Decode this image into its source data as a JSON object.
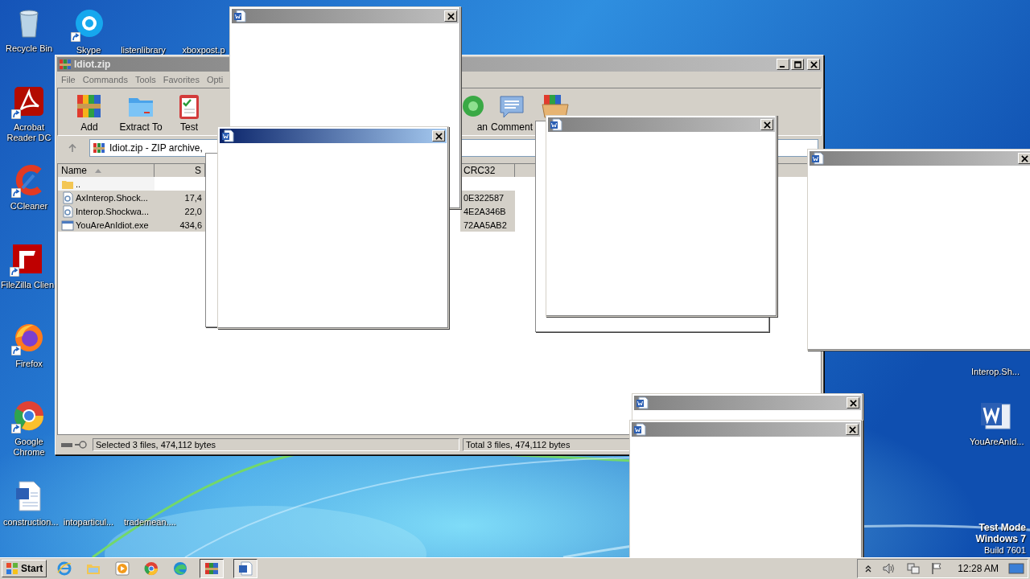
{
  "desktop_icons": [
    {
      "label": "Recycle Bin",
      "kind": "recycle",
      "shortcut": false
    },
    {
      "label": "Skype",
      "kind": "chat",
      "shortcut": true
    },
    {
      "label": "listenlibrary",
      "kind": "blank",
      "shortcut": false
    },
    {
      "label": "xboxpost.p",
      "kind": "blank",
      "shortcut": false
    },
    {
      "label": "Acrobat Reader DC",
      "kind": "pdf",
      "shortcut": true
    },
    {
      "label": "CCleaner",
      "kind": "cleaner",
      "shortcut": true
    },
    {
      "label": "FileZilla Clien",
      "kind": "ftp",
      "shortcut": true
    },
    {
      "label": "Firefox",
      "kind": "firefox",
      "shortcut": true
    },
    {
      "label": "Google Chrome",
      "kind": "chrome",
      "shortcut": true
    },
    {
      "label": "construction...",
      "kind": "doc",
      "shortcut": false
    },
    {
      "label": "intoparticul...",
      "kind": "blank",
      "shortcut": false
    },
    {
      "label": "trademean....",
      "kind": "blank",
      "shortcut": false
    },
    {
      "label": "Interop.Sh...",
      "kind": "blank",
      "shortcut": false
    },
    {
      "label": "YouAreAnId...",
      "kind": "word",
      "shortcut": false
    }
  ],
  "winrar": {
    "title": "Idiot.zip",
    "menu": [
      "File",
      "Commands",
      "Tools",
      "Favorites",
      "Opti"
    ],
    "toolbar": [
      {
        "label": "Add",
        "kind": "add"
      },
      {
        "label": "Extract To",
        "kind": "extract"
      },
      {
        "label": "Test",
        "kind": "test"
      },
      {
        "label": "an",
        "kind": "scan"
      },
      {
        "label": "Comment",
        "kind": "comment"
      },
      {
        "kind": "sfx"
      }
    ],
    "address": "Idiot.zip - ZIP archive,",
    "columns": [
      {
        "label": "Name",
        "sorted": true
      },
      {
        "label": "S",
        "sorted": false
      },
      {
        "label": "CRC32",
        "sorted": false
      }
    ],
    "rows": [
      {
        "name": "..",
        "kind": "folder",
        "selected": false
      },
      {
        "name": "AxInterop.Shock...",
        "kind": "dll",
        "size": "17,4",
        "crc": "0E322587",
        "selected": true
      },
      {
        "name": "Interop.Shockwa...",
        "kind": "dll",
        "size": "22,0",
        "crc": "4E2A346B",
        "selected": true
      },
      {
        "name": "YouAreAnIdiot.exe",
        "kind": "exe",
        "size": "434,6",
        "crc": "72AA5AB2",
        "selected": true
      }
    ],
    "status_selected": "Selected 3 files, 474,112 bytes",
    "status_total": "Total 3 files, 474,112 bytes"
  },
  "popups": [
    {
      "active": false
    },
    {
      "active": true
    },
    {
      "active": false
    },
    {
      "active": false
    },
    {
      "active": false
    },
    {
      "active": false
    }
  ],
  "system_notice": [
    "Test Mode",
    "Windows 7",
    "Build 7601"
  ],
  "taskbar": {
    "start": "Start",
    "apps": [
      {
        "kind": "ie",
        "active": false
      },
      {
        "kind": "explorer",
        "active": false
      },
      {
        "kind": "media",
        "active": false
      },
      {
        "kind": "chrome",
        "active": false
      },
      {
        "kind": "edge",
        "active": false
      },
      {
        "kind": "winrar",
        "active": true
      },
      {
        "kind": "word",
        "active": true
      }
    ],
    "clock": "12:28 AM"
  }
}
